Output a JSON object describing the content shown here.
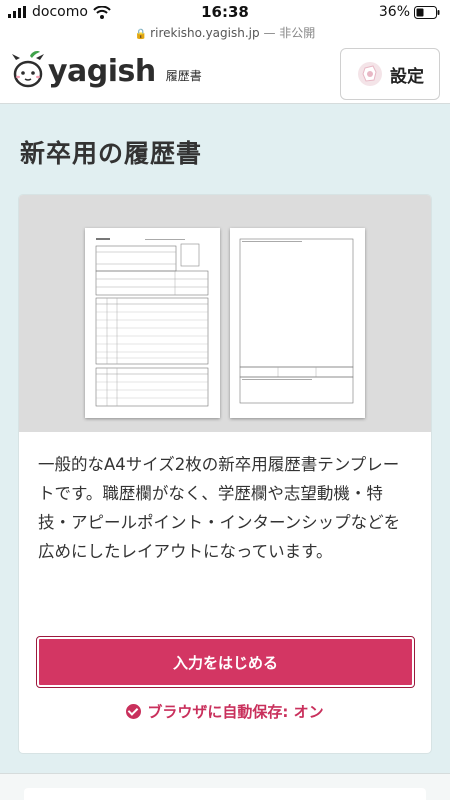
{
  "status_bar": {
    "carrier": "docomo",
    "time": "16:38",
    "battery": "36%"
  },
  "url_bar": {
    "domain": "rirekisho.yagish.jp",
    "visibility": "— 非公開"
  },
  "header": {
    "logo_text": "yagish",
    "logo_sub": "履歴書",
    "settings_label": "設定"
  },
  "page": {
    "title": "新卒用の履歴書"
  },
  "card": {
    "description": "一般的なA4サイズ2枚の新卒用履歴書テンプレートです。職歴欄がなく、学歴欄や志望動機・特技・アピールポイント・インターンシップなどを広めにしたレイアウトになっています。",
    "start_button": "入力をはじめる",
    "autosave_label": "ブラウザに自動保存: オン"
  },
  "colors": {
    "accent": "#d33663",
    "page_bg": "#e1eff1",
    "preview_bg": "#dcdcdc"
  }
}
